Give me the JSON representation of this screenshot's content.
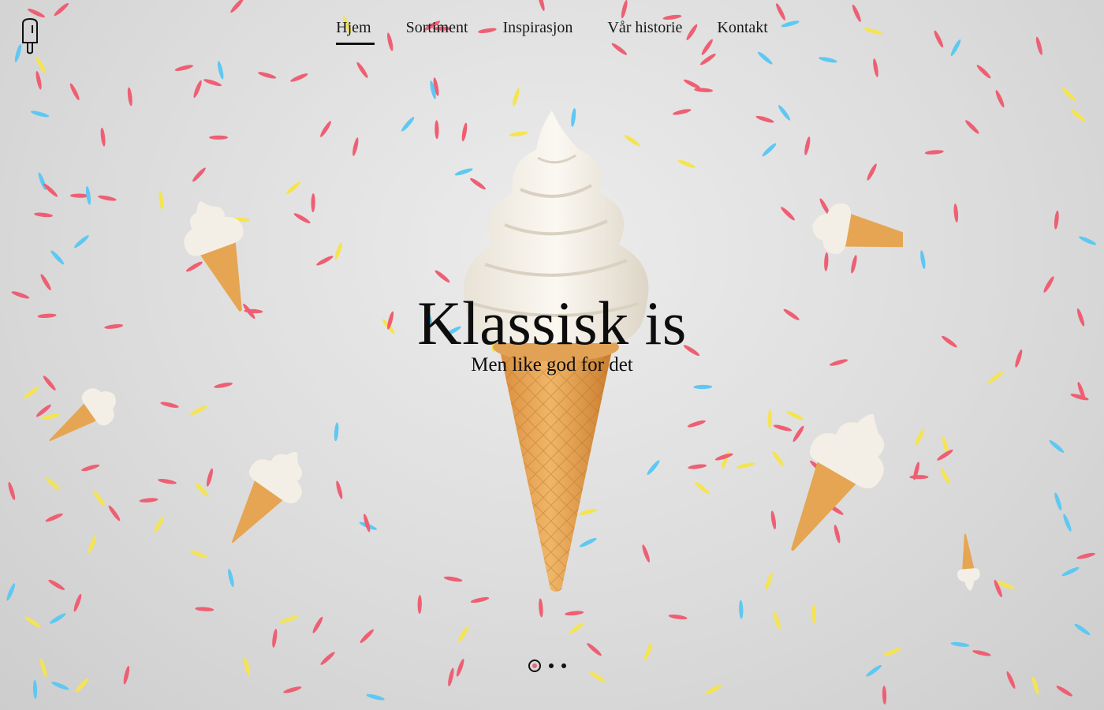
{
  "nav": {
    "items": [
      {
        "label": "Hjem",
        "active": true
      },
      {
        "label": "Sortiment",
        "active": false
      },
      {
        "label": "Inspirasjon",
        "active": false
      },
      {
        "label": "Vår historie",
        "active": false
      },
      {
        "label": "Kontakt",
        "active": false
      }
    ]
  },
  "logo": {
    "icon": "popsicle-icon"
  },
  "hero": {
    "title": "Klassisk is",
    "subtitle": "Men like god for det"
  },
  "slider": {
    "slides": 3,
    "active_index": 0
  },
  "colors": {
    "sprinkle_pink": "#ee5f73",
    "sprinkle_blue": "#5ec8f2",
    "sprinkle_yellow": "#f5e451",
    "cone": "#e8a552",
    "cream": "#f4efe6",
    "text": "#111111"
  }
}
